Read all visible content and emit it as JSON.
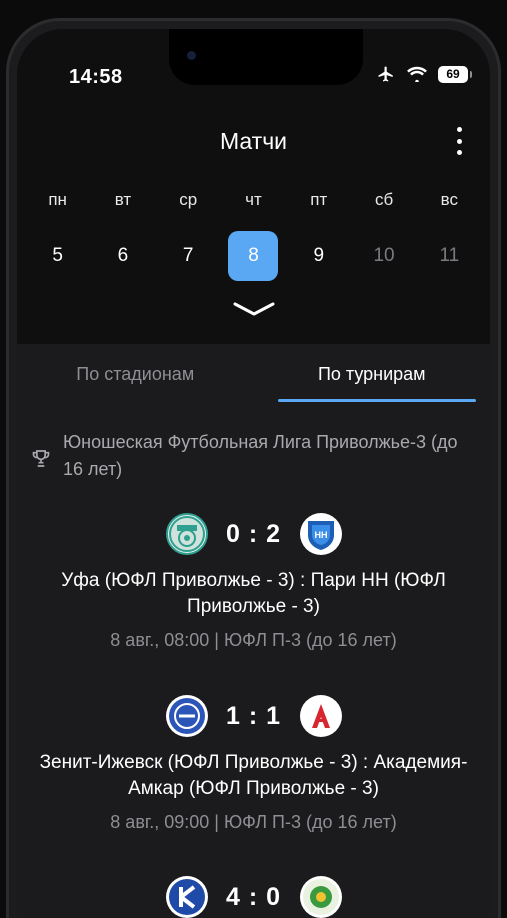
{
  "status": {
    "time": "14:58",
    "battery": "69"
  },
  "header": {
    "title": "Матчи"
  },
  "calendar": {
    "weekdays": [
      "пн",
      "вт",
      "ср",
      "чт",
      "пт",
      "сб",
      "вс"
    ],
    "days": [
      "5",
      "6",
      "7",
      "8",
      "9",
      "10",
      "11"
    ],
    "selected_index": 3
  },
  "tabs": [
    {
      "label": "По стадионам",
      "active": false
    },
    {
      "label": "По турнирам",
      "active": true
    }
  ],
  "tournament": {
    "name": "Юношеская Футбольная Лига Приволжье-3 (до 16 лет)"
  },
  "matches": [
    {
      "score": "0 : 2",
      "teams": "Уфа (ЮФЛ Приволжье - 3) : Пари НН (ЮФЛ Приволжье - 3)",
      "meta": "8 авг., 08:00 | ЮФЛ П-3 (до 16 лет)"
    },
    {
      "score": "1 : 1",
      "teams": "Зенит-Ижевск (ЮФЛ Приволжье - 3) : Академия-Амкар (ЮФЛ Приволжье - 3)",
      "meta": "8 авг., 09:00 | ЮФЛ П-3 (до 16 лет)"
    },
    {
      "score": "4 : 0",
      "teams": "",
      "meta": ""
    }
  ],
  "colors": {
    "accent": "#5aa7f4",
    "background": "#1b1b1d",
    "muted": "#8e8e93"
  },
  "icons": {
    "airplane": "airplane-icon",
    "wifi": "wifi-icon",
    "menu": "more-vertical-icon",
    "cup": "trophy-icon",
    "chevron": "chevron-down-icon"
  }
}
